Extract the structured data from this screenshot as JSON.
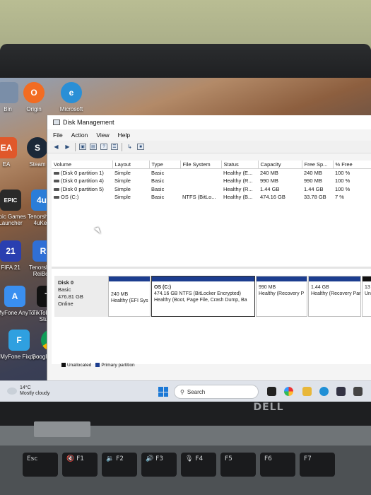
{
  "desktop": {
    "icons": [
      {
        "label": "Bin",
        "glyph": "",
        "color": "#7a8ea8"
      },
      {
        "label": "Origin",
        "glyph": "O",
        "color": "#f26c22"
      },
      {
        "label": "Microsoft",
        "glyph": "e",
        "color": "#2a8fd6"
      },
      {
        "label": "EA",
        "glyph": "EA",
        "color": "#e0582a"
      },
      {
        "label": "Steam",
        "glyph": "S",
        "color": "#1b2838"
      },
      {
        "label": "Epic Games Launcher",
        "glyph": "EPIC",
        "color": "#2a2a2a"
      },
      {
        "label": "Tenorshare 4uKey",
        "glyph": "4u",
        "color": "#2b7dd8"
      },
      {
        "label": "FIFA 21",
        "glyph": "21",
        "color": "#2a3fb0"
      },
      {
        "label": "Tenorshare ReiBoot",
        "glyph": "R",
        "color": "#2f6fd6"
      },
      {
        "label": "iMyFone AnyTo",
        "glyph": "A",
        "color": "#3a8ff0"
      },
      {
        "label": "TikTok LIVE Studio",
        "glyph": "T",
        "color": "#111111"
      },
      {
        "label": "iMyFone Fixppo",
        "glyph": "F",
        "color": "#2fa0e0"
      },
      {
        "label": "Google Chrome",
        "glyph": "",
        "color": "#e0b021"
      }
    ]
  },
  "window": {
    "title": "Disk Management",
    "menu": [
      "File",
      "Action",
      "View",
      "Help"
    ],
    "columns": [
      "Volume",
      "Layout",
      "Type",
      "File System",
      "Status",
      "Capacity",
      "Free Sp...",
      "% Free"
    ],
    "rows": [
      [
        "(Disk 0 partition 1)",
        "Simple",
        "Basic",
        "",
        "Healthy (E...",
        "240 MB",
        "240 MB",
        "100 %"
      ],
      [
        "(Disk 0 partition 4)",
        "Simple",
        "Basic",
        "",
        "Healthy (R...",
        "990 MB",
        "990 MB",
        "100 %"
      ],
      [
        "(Disk 0 partition 5)",
        "Simple",
        "Basic",
        "",
        "Healthy (R...",
        "1.44 GB",
        "1.44 GB",
        "100 %"
      ],
      [
        "OS (C:)",
        "Simple",
        "Basic",
        "NTFS (BitLo...",
        "Healthy (B...",
        "474.16 GB",
        "33.78 GB",
        "7 %"
      ]
    ],
    "disk": {
      "name": "Disk 0",
      "type": "Basic",
      "size": "476.81 GB",
      "status": "Online"
    },
    "partitions": [
      {
        "line1": "",
        "line2": "240 MB",
        "line3": "Healthy (EFI Sys"
      },
      {
        "line1": "OS (C:)",
        "line2": "474.16 GB NTFS (BitLocker Encrypted)",
        "line3": "Healthy (Boot, Page File, Crash Dump, Ba"
      },
      {
        "line1": "",
        "line2": "990 MB",
        "line3": "Healthy (Recovery P"
      },
      {
        "line1": "",
        "line2": "1.44 GB",
        "line3": "Healthy (Recovery Par"
      },
      {
        "line1": "",
        "line2": "13",
        "line3": "Una"
      }
    ],
    "legend": {
      "unallocated": "Unallocated",
      "primary": "Primary partition"
    }
  },
  "taskbar": {
    "temp": "14°C",
    "weather": "Mostly cloudy",
    "search_label": "Search"
  },
  "hardware": {
    "brand": "DELL"
  },
  "keys": [
    "Esc",
    "F1",
    "F2",
    "F3",
    "F4",
    "F5",
    "F6",
    "F7"
  ],
  "colors": {
    "primary_partition": "#1c3d8f",
    "unallocated": "#111111",
    "start": "#1c79d6"
  }
}
